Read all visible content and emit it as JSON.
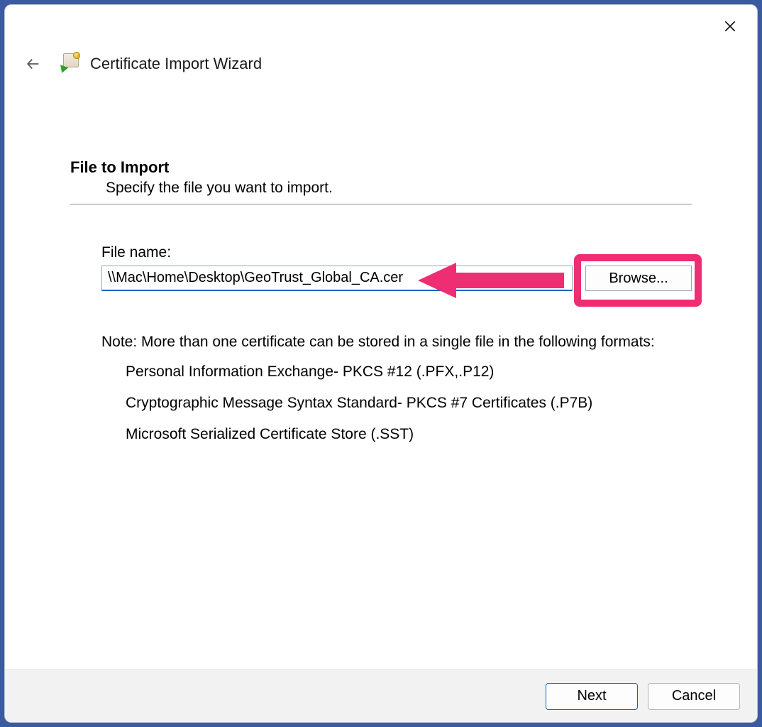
{
  "header": {
    "title": "Certificate Import Wizard"
  },
  "main": {
    "heading": "File to Import",
    "subheading": "Specify the file you want to import.",
    "file_label": "File name:",
    "file_value": "\\\\Mac\\Home\\Desktop\\GeoTrust_Global_CA.cer",
    "browse_label": "Browse...",
    "note_intro": "Note:  More than one certificate can be stored in a single file in the following formats:",
    "formats": [
      "Personal Information Exchange- PKCS #12 (.PFX,.P12)",
      "Cryptographic Message Syntax Standard- PKCS #7 Certificates (.P7B)",
      "Microsoft Serialized Certificate Store (.SST)"
    ]
  },
  "footer": {
    "next": "Next",
    "cancel": "Cancel"
  },
  "annotation": {
    "color": "#ef2d72"
  }
}
